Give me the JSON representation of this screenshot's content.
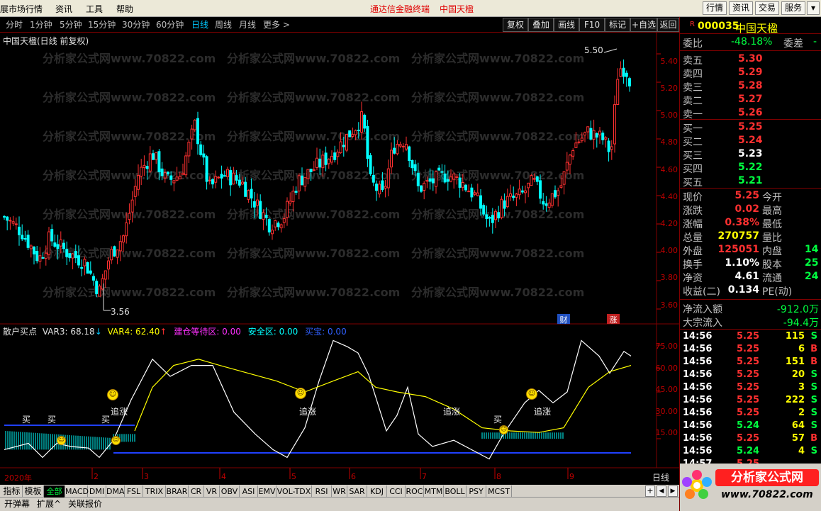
{
  "menu": {
    "items": [
      "展市场行情",
      "资讯",
      "工具",
      "帮助"
    ],
    "caption_app": "通达信金融终端",
    "caption_stock": "中国天楹",
    "right_buttons": [
      "行情",
      "资讯",
      "交易",
      "服务"
    ]
  },
  "periods": {
    "items": [
      "分时",
      "1分钟",
      "5分钟",
      "15分钟",
      "30分钟",
      "60分钟",
      "日线",
      "周线",
      "月线",
      "更多 >"
    ],
    "active": "日线"
  },
  "toolbar": [
    "复权",
    "叠加",
    "画线",
    "F10",
    "标记",
    "+自选",
    "返回"
  ],
  "chart": {
    "title": "中国天楹(日线 前复权)",
    "high_label": "5.50",
    "low_label": "3.56",
    "markers": {
      "cai": "财",
      "zhang": "涨"
    },
    "watermark": "分析家公式网www.70822.com",
    "price_ticks": [
      "5.40",
      "5.20",
      "5.00",
      "4.80",
      "4.60",
      "4.40",
      "4.20",
      "4.00",
      "3.80",
      "3.60"
    ],
    "x_ticks": [
      "2020年",
      "2",
      "3",
      "4",
      "5",
      "6",
      "7",
      "8",
      "9"
    ],
    "period_label": "日线"
  },
  "chart_data": {
    "type": "candlestick",
    "title": "中国天楹(日线 前复权)",
    "ylim": [
      3.5,
      5.55
    ],
    "x": [
      "2020年",
      "2",
      "3",
      "4",
      "5",
      "6",
      "7",
      "8",
      "9"
    ],
    "annotations": [
      {
        "label": "5.50",
        "value": 5.5
      },
      {
        "label": "3.56",
        "value": 3.56
      }
    ],
    "indicator": {
      "name": "散户买点",
      "series": [
        {
          "name": "VAR3",
          "last": 68.18
        },
        {
          "name": "VAR4",
          "last": 62.4
        },
        {
          "name": "建仓等待区",
          "last": 0.0
        },
        {
          "name": "安全区",
          "last": 0.0
        },
        {
          "name": "买宝",
          "last": 0.0
        }
      ],
      "ylim": [
        0,
        80
      ],
      "ticks": [
        "75.00",
        "60.00",
        "45.00",
        "30.00",
        "15.00"
      ]
    }
  },
  "indicator": {
    "name": "散户买点",
    "var3": "VAR3: 68.18",
    "var3_arrow": "↓",
    "var4": "VAR4: 62.40",
    "var4_arrow": "↑",
    "zone1": "建仓等待区: 0.00",
    "zone2": "安全区: 0.00",
    "zone3": "买宝: 0.00",
    "ticks": [
      "75.00",
      "60.00",
      "45.00",
      "30.00",
      "15.00"
    ],
    "buy": "买",
    "chase": "追涨"
  },
  "quote": {
    "flag": "R",
    "code": "000035",
    "name": "中国天楹",
    "weibi_label": "委比",
    "weibi_value": "-48.18%",
    "weicha_label": "委差",
    "weicha_value": "-",
    "sell": [
      {
        "label": "卖五",
        "price": "5.30"
      },
      {
        "label": "卖四",
        "price": "5.29"
      },
      {
        "label": "卖三",
        "price": "5.28"
      },
      {
        "label": "卖二",
        "price": "5.27"
      },
      {
        "label": "卖一",
        "price": "5.26"
      }
    ],
    "buy": [
      {
        "label": "买一",
        "price": "5.25"
      },
      {
        "label": "买二",
        "price": "5.24"
      },
      {
        "label": "买三",
        "price": "5.23"
      },
      {
        "label": "买四",
        "price": "5.22"
      },
      {
        "label": "买五",
        "price": "5.21"
      }
    ],
    "stats": [
      {
        "l": "现价",
        "v": "5.25",
        "l2": "今开",
        "v2": ""
      },
      {
        "l": "涨跌",
        "v": "0.02",
        "l2": "最高",
        "v2": ""
      },
      {
        "l": "涨幅",
        "v": "0.38%",
        "l2": "最低",
        "v2": ""
      },
      {
        "l": "总量",
        "v": "270757",
        "l2": "量比",
        "v2": ""
      },
      {
        "l": "外盘",
        "v": "125051",
        "l2": "内盘",
        "v2": "14"
      },
      {
        "l": "换手",
        "v": "1.10%",
        "l2": "股本",
        "v2": "25"
      },
      {
        "l": "净资",
        "v": "4.61",
        "l2": "流通",
        "v2": "24"
      },
      {
        "l": "收益(二)",
        "v": "0.134",
        "l2": "PE(动)",
        "v2": ""
      }
    ],
    "netflow_label": "净流入额",
    "netflow_value": "-912.0万",
    "block_label": "大宗流入",
    "block_value": "-94.4万"
  },
  "trades": [
    {
      "t": "14:56",
      "p": "5.25",
      "v": "115",
      "s": "S"
    },
    {
      "t": "14:56",
      "p": "5.25",
      "v": "6",
      "s": "B"
    },
    {
      "t": "14:56",
      "p": "5.25",
      "v": "151",
      "s": "B"
    },
    {
      "t": "14:56",
      "p": "5.25",
      "v": "20",
      "s": "S"
    },
    {
      "t": "14:56",
      "p": "5.25",
      "v": "3",
      "s": "S"
    },
    {
      "t": "14:56",
      "p": "5.25",
      "v": "222",
      "s": "S"
    },
    {
      "t": "14:56",
      "p": "5.25",
      "v": "2",
      "s": "S"
    },
    {
      "t": "14:56",
      "p": "5.24",
      "v": "64",
      "s": "S"
    },
    {
      "t": "14:56",
      "p": "5.25",
      "v": "57",
      "s": "B"
    },
    {
      "t": "14:56",
      "p": "5.24",
      "v": "4",
      "s": "S"
    },
    {
      "t": "14:57",
      "p": "5.25",
      "v": "",
      "s": ""
    }
  ],
  "tabs": {
    "row1": [
      "指标",
      "模板",
      "全部",
      "MACD",
      "DMI",
      "DMA",
      "FSL",
      "TRIX",
      "BRAR",
      "CR",
      "VR",
      "OBV",
      "ASI",
      "EMV",
      "VOL-TDX",
      "RSI",
      "WR",
      "SAR",
      "KDJ",
      "CCI",
      "ROC",
      "MTM",
      "BOLL",
      "PSY",
      "MCST"
    ],
    "active": "全部",
    "row2": [
      "开弹幕",
      "扩展^",
      "关联报价"
    ]
  },
  "logo": {
    "text": "分析家公式网",
    "url": "www.70822.com"
  },
  "colors": {
    "up": "#ff3030",
    "down": "#00ffff",
    "label_red": "#ff3030",
    "green": "#00ff40",
    "yellow": "#ffff00"
  }
}
